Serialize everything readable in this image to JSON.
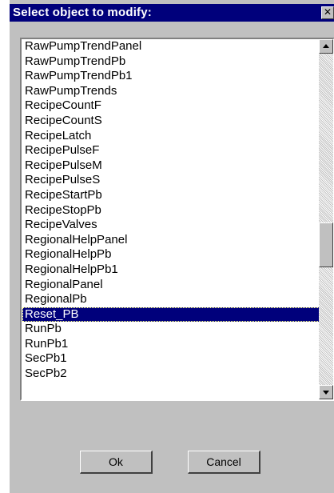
{
  "dialog": {
    "title": "Select object to modify:",
    "close_glyph": "✕"
  },
  "list": {
    "items": [
      "RawPumpTrendPanel",
      "RawPumpTrendPb",
      "RawPumpTrendPb1",
      "RawPumpTrends",
      "RecipeCountF",
      "RecipeCountS",
      "RecipeLatch",
      "RecipePulseF",
      "RecipePulseM",
      "RecipePulseS",
      "RecipeStartPb",
      "RecipeStopPb",
      "RecipeValves",
      "RegionalHelpPanel",
      "RegionalHelpPb",
      "RegionalHelpPb1",
      "RegionalPanel",
      "RegionalPb",
      "Reset_PB",
      "RunPb",
      "RunPb1",
      "SecPb1",
      "SecPb2"
    ],
    "selected": "Reset_PB"
  },
  "buttons": {
    "ok_label": "Ok",
    "cancel_label": "Cancel"
  },
  "colors": {
    "titlebar": "#00007b",
    "window_face": "#c0c0c0",
    "selection": "#00007b"
  }
}
